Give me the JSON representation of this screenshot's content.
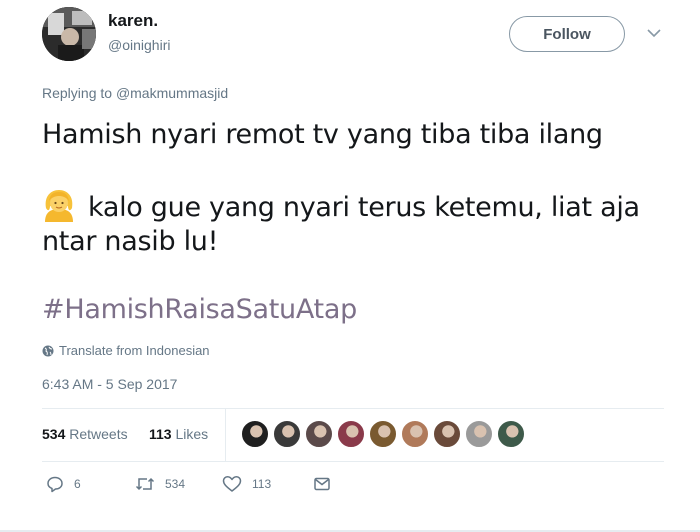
{
  "user": {
    "display_name": "karen.",
    "username": "@oinighiri",
    "avatar_icon": "avatar-photo"
  },
  "header": {
    "follow_label": "Follow",
    "more_icon": "chevron-down-icon"
  },
  "reply": {
    "prefix": "Replying to",
    "mention": "@makmummasjid"
  },
  "tweet": {
    "line1": "Hamish nyari remot tv yang tiba tiba ilang",
    "line2": "kalo gue yang nyari terus ketemu, liat aja",
    "line3": "ntar nasib lu!",
    "emoji": "person-with-blond-hair-emoji",
    "hashtag": "#HamishRaisaSatuAtap"
  },
  "translate": {
    "label": "Translate from Indonesian",
    "icon": "globe-icon"
  },
  "timestamp": "6:43 AM - 5 Sep 2017",
  "stats": {
    "retweets_count": "534",
    "retweets_label": "Retweets",
    "likes_count": "113",
    "likes_label": "Likes",
    "likers": [
      {
        "color": "#1f1f1f"
      },
      {
        "color": "#3a3a3a"
      },
      {
        "color": "#5b4a4a"
      },
      {
        "color": "#8a3a4a"
      },
      {
        "color": "#7a5a30"
      },
      {
        "color": "#b07a5a"
      },
      {
        "color": "#6a4a3a"
      },
      {
        "color": "#9a9a9a"
      },
      {
        "color": "#3e5a4a"
      }
    ]
  },
  "actions": {
    "reply_count": "6",
    "retweet_count": "534",
    "like_count": "113"
  },
  "colors": {
    "text": "#14171a",
    "secondary": "#657786",
    "hashtag": "#7d7089",
    "border": "#e6ecf0"
  }
}
